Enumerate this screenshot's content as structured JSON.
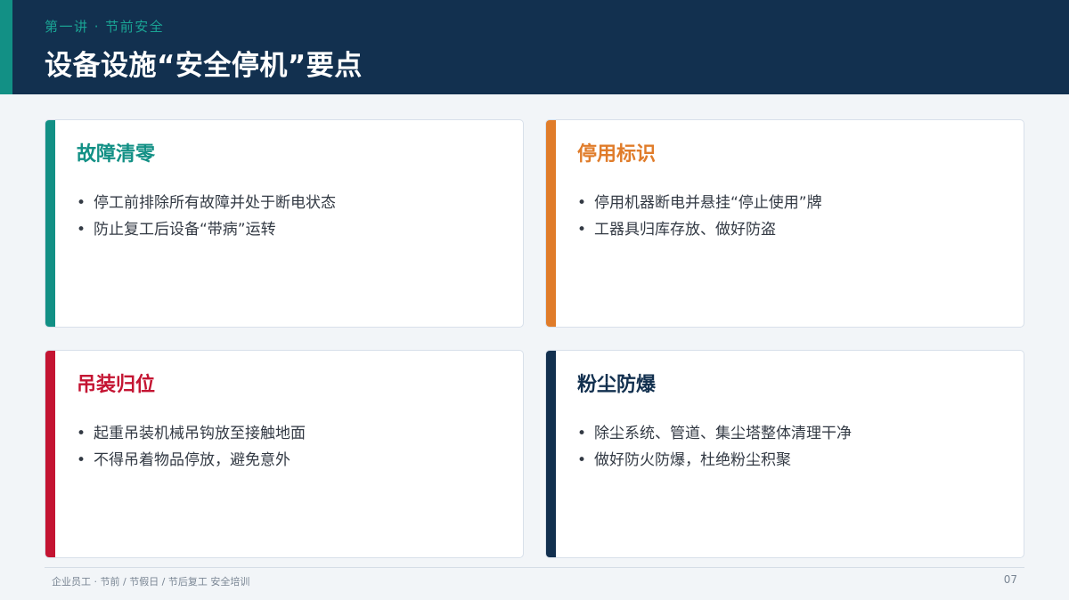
{
  "header": {
    "kicker": "第一讲 · 节前安全",
    "title": "设备设施“安全停机”要点"
  },
  "colors": {
    "teal": "#129085",
    "orange": "#e07c2a",
    "red": "#c41432",
    "navy": "#12304f"
  },
  "cards": [
    {
      "title": "故障清零",
      "items": [
        "停工前排除所有故障并处于断电状态",
        "防止复工后设备“带病”运转"
      ]
    },
    {
      "title": "停用标识",
      "items": [
        "停用机器断电并悬挂“停止使用”牌",
        "工器具归库存放、做好防盗"
      ]
    },
    {
      "title": "吊装归位",
      "items": [
        "起重吊装机械吊钩放至接触地面",
        "不得吊着物品停放，避免意外"
      ]
    },
    {
      "title": "粉尘防爆",
      "items": [
        "除尘系统、管道、集尘塔整体清理干净",
        "做好防火防爆，杜绝粉尘积聚"
      ]
    }
  ],
  "footer": {
    "text": "企业员工 · 节前 / 节假日 / 节后复工 安全培训",
    "page": "07"
  }
}
